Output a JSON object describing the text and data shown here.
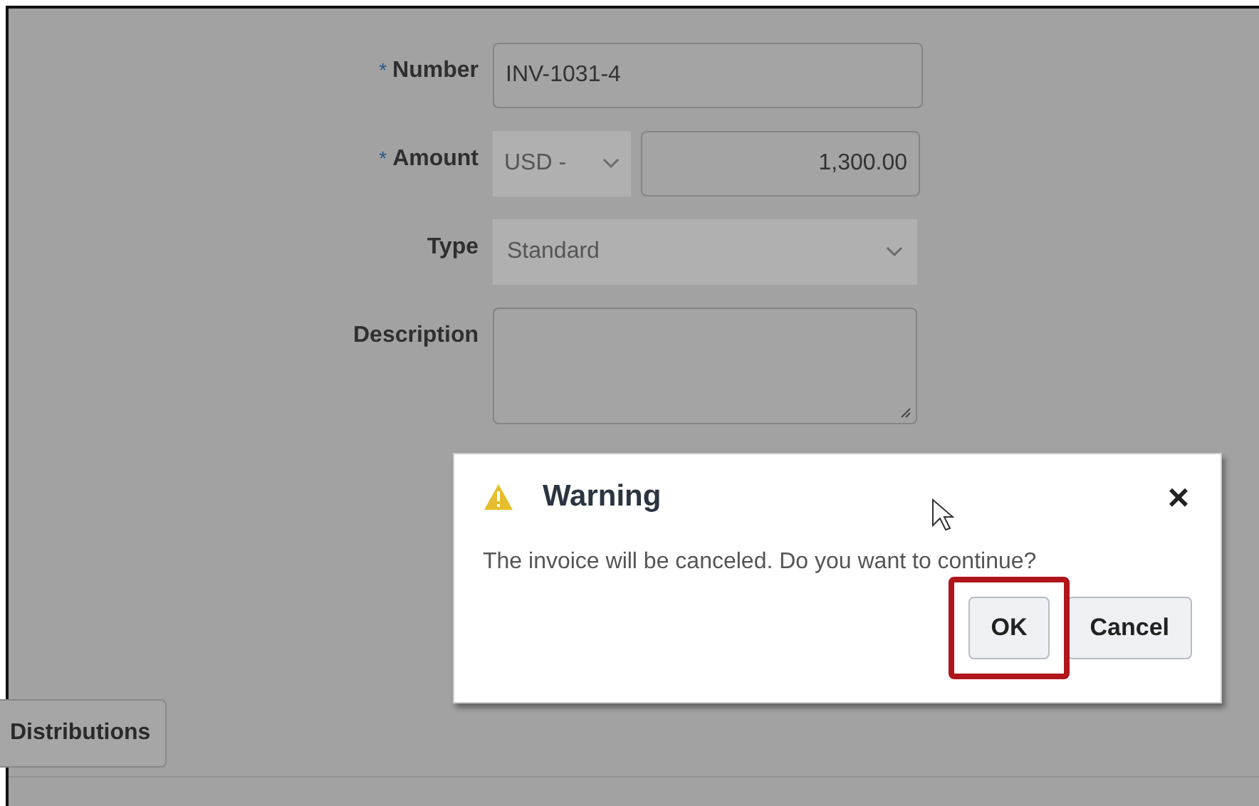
{
  "form": {
    "fields": [
      {
        "kind": "text",
        "label": "Number",
        "required_mark": "*",
        "value": "INV-1031-4"
      },
      {
        "kind": "amount",
        "label": "Amount",
        "required_mark": "*",
        "currency": {
          "value": "USD -",
          "disabled": true
        },
        "value": "1,300.00"
      },
      {
        "kind": "select",
        "label": "Type",
        "value": "Standard",
        "disabled": true
      },
      {
        "kind": "textarea",
        "label": "Description"
      }
    ]
  },
  "tabs": [
    {
      "label": "Distributions",
      "selected": false
    }
  ],
  "dialog": {
    "title": "Warning",
    "message": "The invoice will be canceled. Do you want to continue?",
    "close": "×",
    "buttons": [
      {
        "label": "OK",
        "highlighted": true
      },
      {
        "label": "Cancel",
        "highlighted": false
      }
    ]
  }
}
